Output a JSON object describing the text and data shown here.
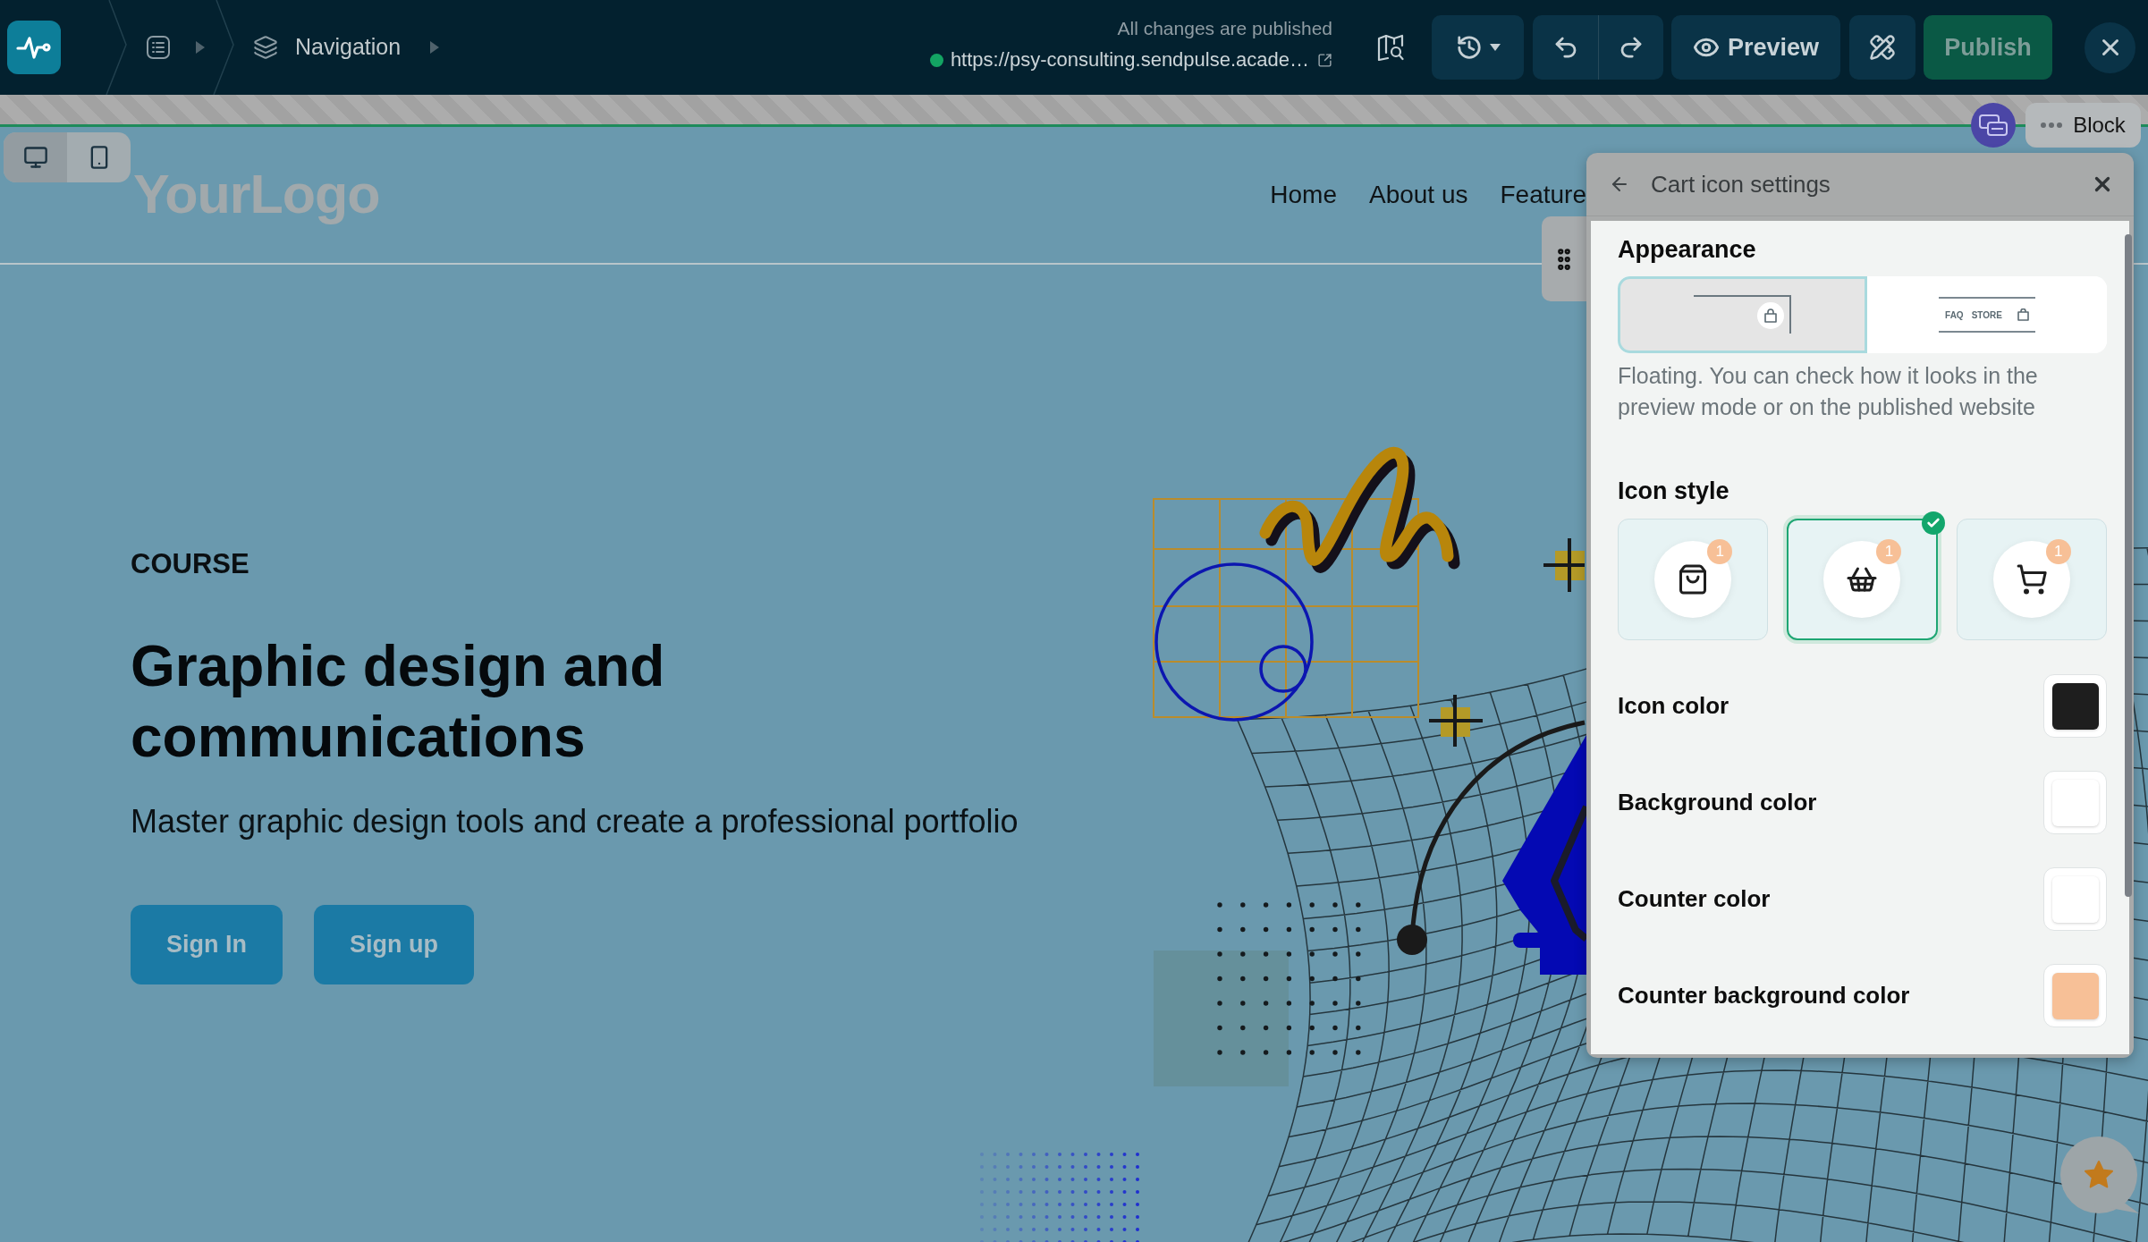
{
  "breadcrumb": {
    "current": "Navigation"
  },
  "status": {
    "message": "All changes are published",
    "url": "https://psy-consulting.sendpulse.acade…",
    "live": true
  },
  "actions": {
    "preview": "Preview",
    "publish": {
      "label": "Publish",
      "disabled": true
    }
  },
  "devices": [
    {
      "kind": "desktop",
      "selected": true
    },
    {
      "kind": "mobile",
      "selected": false
    }
  ],
  "site_header": {
    "logo": "YourLogo",
    "nav": [
      "Home",
      "About us",
      "Feature"
    ]
  },
  "hero": {
    "eyebrow": "COURSE",
    "title": "Graphic design and communications",
    "subtitle": "Master graphic design tools and create a professional portfolio",
    "buttons": [
      "Sign In",
      "Sign up"
    ]
  },
  "block_toolbar": {
    "label": "Block"
  },
  "settings_panel": {
    "title": "Cart icon settings",
    "appearance": {
      "heading": "Appearance",
      "options": [
        {
          "kind": "floating",
          "selected": true
        },
        {
          "kind": "menu",
          "selected": false,
          "labels": [
            "FAQ",
            "STORE"
          ]
        }
      ],
      "description": "Floating. You can check how it looks in the preview mode or on the published website"
    },
    "icon_style": {
      "heading": "Icon style",
      "options": [
        {
          "kind": "bag",
          "selected": false,
          "counter": "1"
        },
        {
          "kind": "basket",
          "selected": true,
          "counter": "1"
        },
        {
          "kind": "cart",
          "selected": false,
          "counter": "1"
        }
      ]
    },
    "colors": [
      {
        "label": "Icon color",
        "color": "#1e1e1e"
      },
      {
        "label": "Background color",
        "color": "#ffffff"
      },
      {
        "label": "Counter color",
        "color": "#ffffff"
      },
      {
        "label": "Counter background color",
        "color": "#f7c097"
      }
    ]
  }
}
